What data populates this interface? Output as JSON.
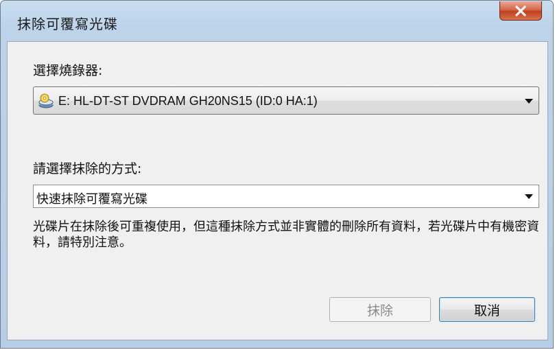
{
  "window": {
    "title": "抹除可覆寫光碟",
    "close_glyph": "X"
  },
  "recorder": {
    "label": "選擇燒錄器:",
    "selected": "E: HL-DT-ST DVDRAM GH20NS15  (ID:0 HA:1)",
    "icon": "optical-drive-icon"
  },
  "method": {
    "label": "請選擇抹除的方式:",
    "selected": "快速抹除可覆寫光碟",
    "description": "光碟片在抹除後可重複使用，但這種抹除方式並非實體的刪除所有資料，若光碟片中有機密資料，請特別注意。"
  },
  "buttons": {
    "erase": "抹除",
    "cancel": "取消"
  },
  "colors": {
    "close_button": "#c9502e",
    "default_button_border": "#3c7fb1"
  }
}
